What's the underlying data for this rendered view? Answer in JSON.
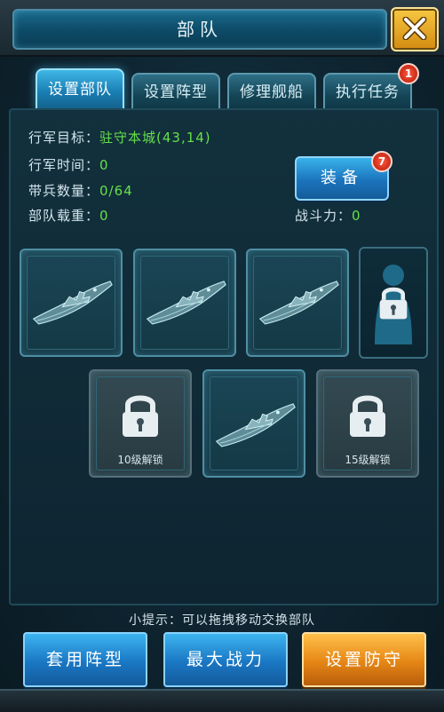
{
  "window": {
    "title": "部队",
    "close_icon": "close-x-icon"
  },
  "tabs": [
    {
      "label": "设置部队",
      "active": true
    },
    {
      "label": "设置阵型",
      "active": false
    },
    {
      "label": "修理舰船",
      "active": false
    },
    {
      "label": "执行任务",
      "active": false,
      "badge": "1"
    }
  ],
  "info": {
    "march_target_label": "行军目标：",
    "march_target_value": "驻守本城(43,14)",
    "march_time_label": "行军时间：",
    "march_time_value": "0",
    "troops_label": "带兵数量：",
    "troops_value": "0/64",
    "load_label": "部队载重：",
    "load_value": "0",
    "power_label": "战斗力：",
    "power_value": "0"
  },
  "equip_button": {
    "label": "装备",
    "badge": "7"
  },
  "slots": {
    "row1": [
      "ship",
      "ship",
      "ship",
      "commander-locked"
    ],
    "row2": [
      {
        "type": "locked",
        "label": "10级解锁"
      },
      {
        "type": "ship"
      },
      {
        "type": "locked",
        "label": "15级解锁"
      }
    ]
  },
  "hint": "小提示：可以拖拽移动交换部队",
  "buttons": {
    "apply_formation": "套用阵型",
    "max_power": "最大战力",
    "set_defense": "设置防守"
  },
  "colors": {
    "accent_blue": "#1a77c4",
    "accent_orange": "#e58616",
    "green_text": "#66e04a",
    "badge_red": "#b3180b"
  }
}
